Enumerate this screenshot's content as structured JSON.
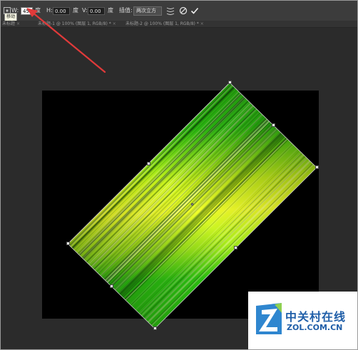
{
  "options_bar": {
    "w_label": "W:",
    "w_value": "45",
    "w_unit": "度",
    "h_label": "H:",
    "h_value": "0.00",
    "h_unit": "度",
    "v_label": "V:",
    "v_value": "0.00",
    "v_unit": "度",
    "interp_label": "插值:",
    "interp_value": "两次立方",
    "tooltip": "移动"
  },
  "tabs": [
    {
      "label": "未标题",
      "close": "×"
    },
    {
      "label": "未标题-1 @ 100% (图层 1, RGB/8) *",
      "close": "×"
    },
    {
      "label": "未标题-2 @ 100% (图层 1, RGB/8) *",
      "close": "×"
    }
  ],
  "icons": {
    "warp": "warp-icon",
    "cancel": "cancel-icon",
    "commit": "commit-icon"
  },
  "colors": {
    "app_bg": "#2b2b2b",
    "canvas_bg": "#000000",
    "arrow": "#e03a3a",
    "gradient_green": "#2fcf12",
    "gradient_yellow": "#f2ff2a"
  },
  "watermark": {
    "cn": "中关村在线",
    "en": "ZOL.COM.CN"
  }
}
